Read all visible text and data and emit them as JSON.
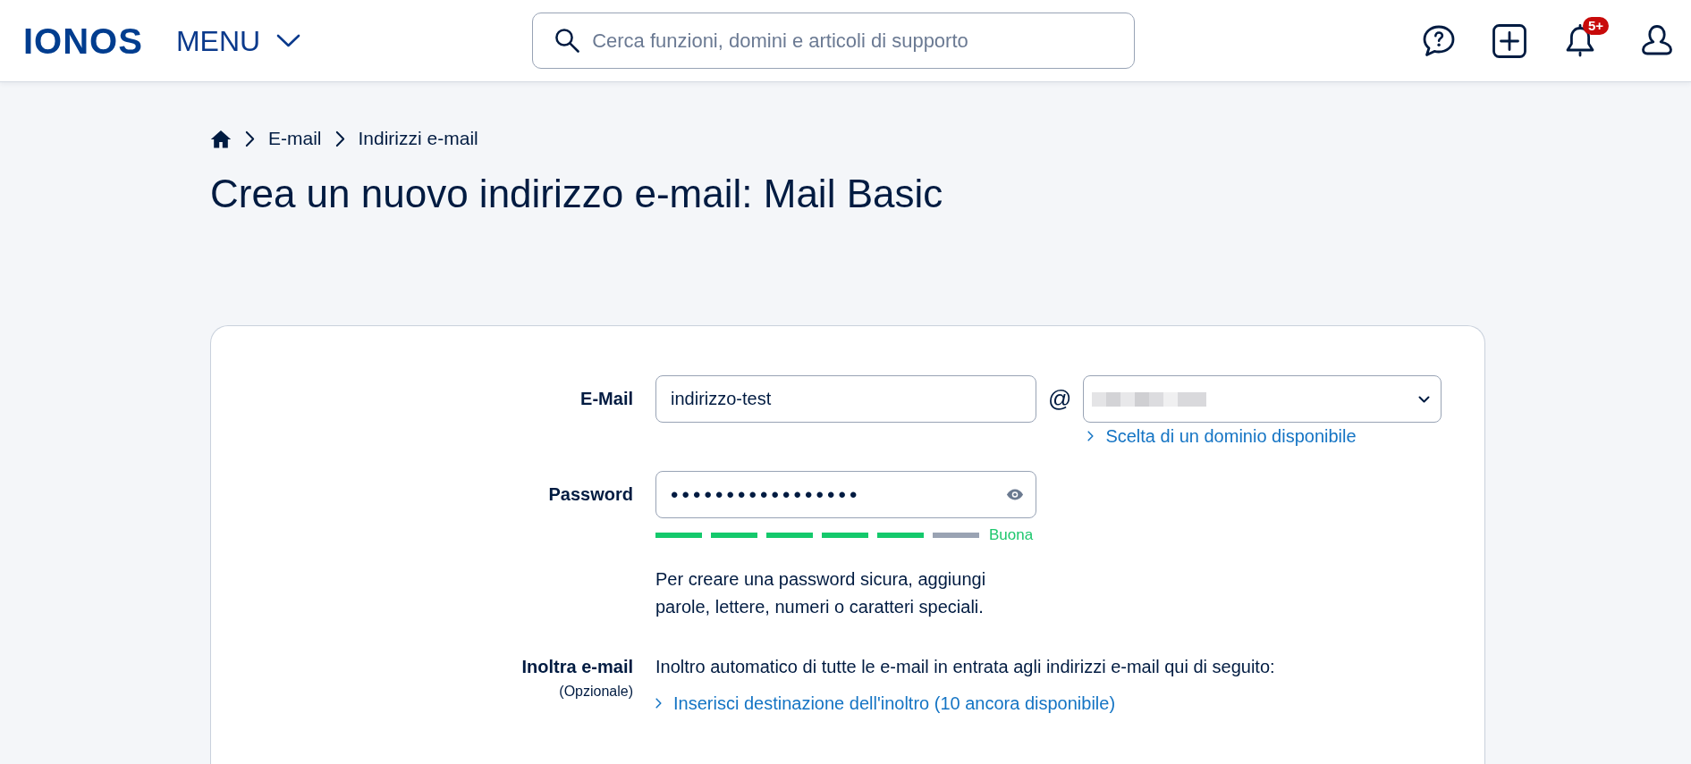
{
  "header": {
    "logo": "IONOS",
    "menu_label": "MENU",
    "search": {
      "placeholder": "Cerca funzioni, domini e articoli di supporto"
    },
    "notification_badge": "5+"
  },
  "breadcrumb": [
    "E-mail",
    "Indirizzi e-mail"
  ],
  "title": "Crea un nuovo indirizzo e-mail: Mail Basic",
  "form": {
    "email": {
      "label": "E-Mail",
      "value": "indirizzo-test",
      "at_sign": "@",
      "domain_link": "Scelta di un dominio disponibile"
    },
    "password": {
      "label": "Password",
      "value": "•••••••••••••••••",
      "strength": {
        "level": 0.83,
        "label": "Buona"
      },
      "hint": "Per creare una password sicura, aggiungi\nparole, lettere, numeri o caratteri speciali."
    },
    "forward": {
      "label": "Inoltra e-mail",
      "note": "(Opzionale)",
      "description": "Inoltro automatico di tutte le e-mail in entrata agli indirizzi e-mail qui di seguito:",
      "link": "Inserisci destinazione dell'inoltro (10 ancora disponibile)"
    }
  }
}
